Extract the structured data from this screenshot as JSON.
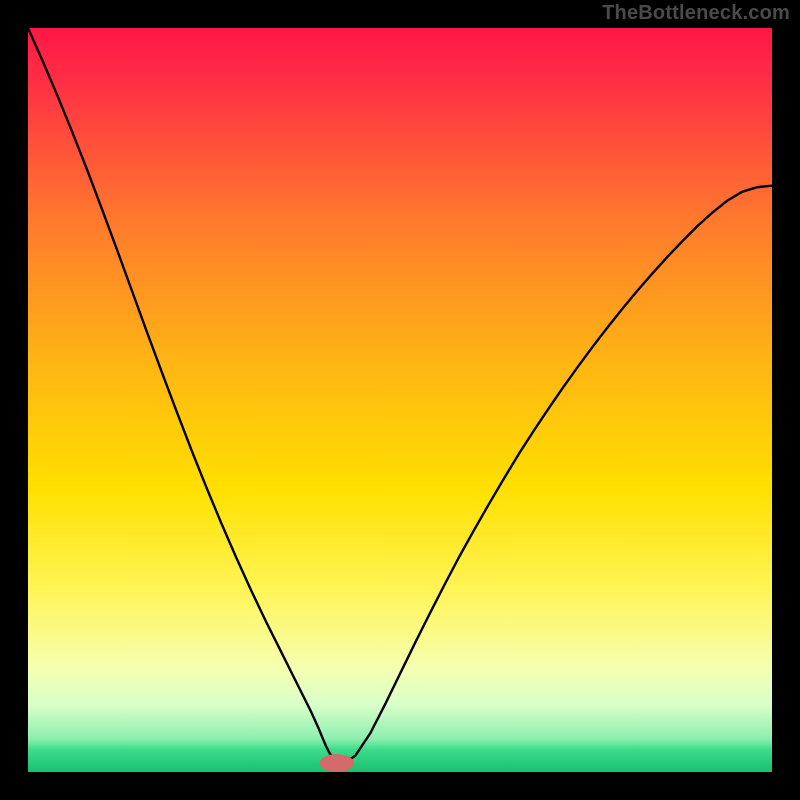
{
  "watermark": "TheBottleneck.com",
  "chart_data": {
    "type": "line",
    "title": "",
    "xlabel": "",
    "ylabel": "",
    "xlim": [
      0,
      100
    ],
    "ylim": [
      0,
      100
    ],
    "grid": false,
    "legend": false,
    "gradient_stops": [
      {
        "offset": 0.0,
        "color": "#ff1744"
      },
      {
        "offset": 0.06,
        "color": "#ff2a46"
      },
      {
        "offset": 0.26,
        "color": "#ff7a2d"
      },
      {
        "offset": 0.46,
        "color": "#ffb812"
      },
      {
        "offset": 0.62,
        "color": "#ffe000"
      },
      {
        "offset": 0.76,
        "color": "#fff55a"
      },
      {
        "offset": 0.86,
        "color": "#f5ffb0"
      },
      {
        "offset": 0.91,
        "color": "#d8ffc8"
      },
      {
        "offset": 0.955,
        "color": "#8fefb0"
      },
      {
        "offset": 0.97,
        "color": "#3bdc8a"
      },
      {
        "offset": 1.0,
        "color": "#19c06f"
      }
    ],
    "minimum_marker": {
      "x": 41.5,
      "y": 1.2,
      "color": "#d46a6a",
      "rx": 2.3,
      "ry": 1.2
    },
    "series": [
      {
        "name": "bottleneck-curve",
        "color": "#000000",
        "x": [
          0,
          2,
          4,
          6,
          8,
          10,
          12,
          14,
          16,
          18,
          20,
          22,
          24,
          26,
          28,
          30,
          31,
          32,
          33,
          34,
          35,
          36,
          37,
          38,
          39,
          39.5,
          40,
          40.5,
          41,
          41.5,
          42,
          42.8,
          44,
          46,
          48,
          50,
          52,
          54,
          56,
          58,
          60,
          62,
          64,
          66,
          68,
          70,
          72,
          74,
          76,
          78,
          80,
          82,
          84,
          86,
          88,
          90,
          92,
          94,
          96,
          98,
          100
        ],
        "y": [
          100,
          95.5,
          90.8,
          85.9,
          80.8,
          75.5,
          70.1,
          64.6,
          59.1,
          53.7,
          48.4,
          43.2,
          38.2,
          33.4,
          28.8,
          24.4,
          22.3,
          20.2,
          18.2,
          16.2,
          14.2,
          12.2,
          10.2,
          8.2,
          6.0,
          4.8,
          3.6,
          2.6,
          1.8,
          1.2,
          1.2,
          1.4,
          2.2,
          5.2,
          9.1,
          13.2,
          17.3,
          21.3,
          25.2,
          29.0,
          32.6,
          36.1,
          39.5,
          42.8,
          45.9,
          48.9,
          51.8,
          54.6,
          57.3,
          59.9,
          62.4,
          64.8,
          67.1,
          69.3,
          71.4,
          73.4,
          75.2,
          76.8,
          78.0,
          78.6,
          78.8
        ]
      }
    ]
  }
}
